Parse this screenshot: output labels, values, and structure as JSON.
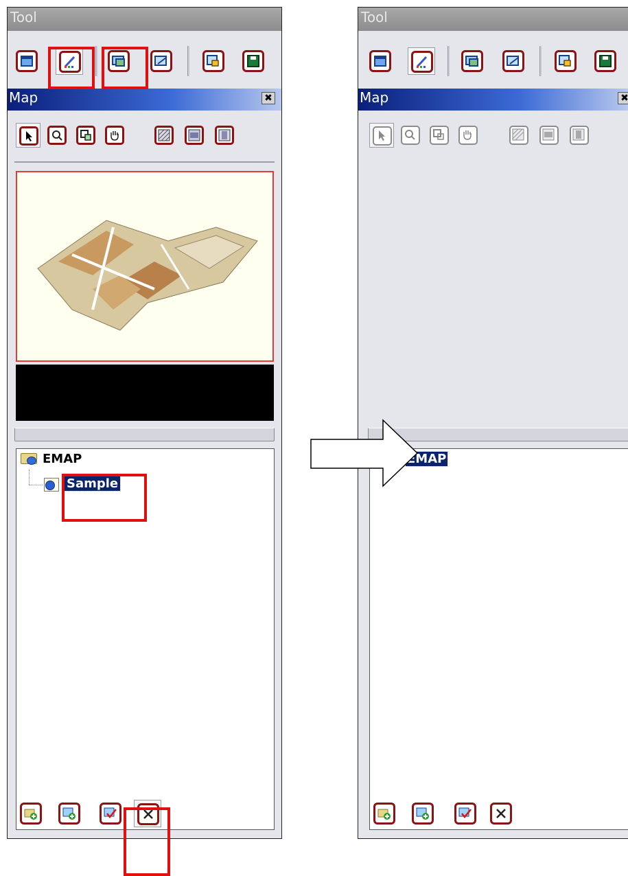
{
  "left": {
    "tool_title": "Tool",
    "map_title": "Map",
    "close_glyph": "✖",
    "toolbar_icons": [
      "window-icon",
      "edit-icon",
      "map-image-icon",
      "form-icon",
      "lock-icon",
      "save-icon"
    ],
    "map_tools": [
      "select-arrow-icon",
      "zoom-icon",
      "zoom-region-icon",
      "pan-hand-icon",
      "hatch-diagonal-icon",
      "hatch-horizontal-icon",
      "hatch-vertical-icon"
    ],
    "tree": {
      "root_label": "EMAP",
      "child_label": "Sample"
    },
    "bottom_icons": [
      "add-folder-icon",
      "add-map-icon",
      "check-map-icon",
      "delete-icon"
    ]
  },
  "right": {
    "tool_title": "Tool",
    "map_title": "Map",
    "close_glyph": "✖",
    "tree": {
      "root_label": "EMAP"
    }
  },
  "colors": {
    "accent_red": "#e01010",
    "icon_border": "#8a1414",
    "title_blue": "#0a246a"
  }
}
